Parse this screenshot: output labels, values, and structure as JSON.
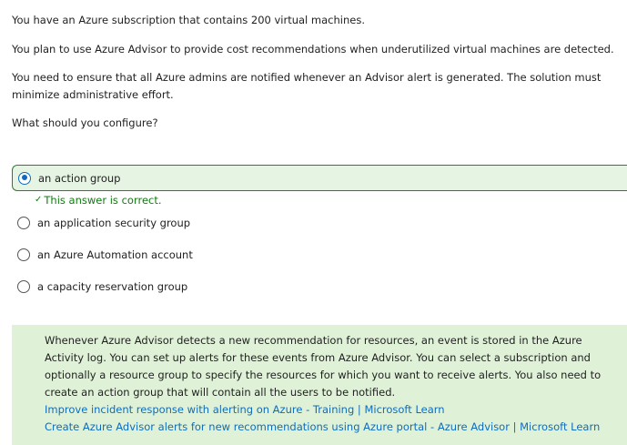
{
  "question": {
    "line1": "You have an Azure subscription that contains 200 virtual machines.",
    "line2": "You plan to use Azure Advisor to provide cost recommendations when underutilized virtual machines are detected.",
    "line3": "You need to ensure that all Azure admins are notified whenever an Advisor alert is generated. The solution must minimize administrative effort.",
    "prompt": "What should you configure?"
  },
  "options": [
    {
      "label": "an action group",
      "selected": true
    },
    {
      "label": "an application security group",
      "selected": false
    },
    {
      "label": "an Azure Automation account",
      "selected": false
    },
    {
      "label": "a capacity reservation group",
      "selected": false
    }
  ],
  "feedback": {
    "icon": "checkmark-icon",
    "text": "This answer is correct.",
    "color": "#107c10"
  },
  "explanation": {
    "text": "Whenever Azure Advisor detects a new recommendation for resources, an event is stored in the Azure Activity log. You can set up alerts for these events from Azure Advisor. You can select a subscription and optionally a resource group to specify the resources for which you want to receive alerts. You also need to create an action group that will contain all the users to be notified.",
    "links": [
      "Improve incident response with alerting on Azure - Training | Microsoft Learn",
      "Create Azure Advisor alerts for new recommendations using Azure portal - Azure Advisor | Microsoft Learn"
    ],
    "background": "#dff2d8",
    "link_color": "#0f6cbd"
  },
  "colors": {
    "selected_border": "#2e7d32",
    "selected_background": "#e6f4e3",
    "radio_accent": "#0f6cbd"
  }
}
